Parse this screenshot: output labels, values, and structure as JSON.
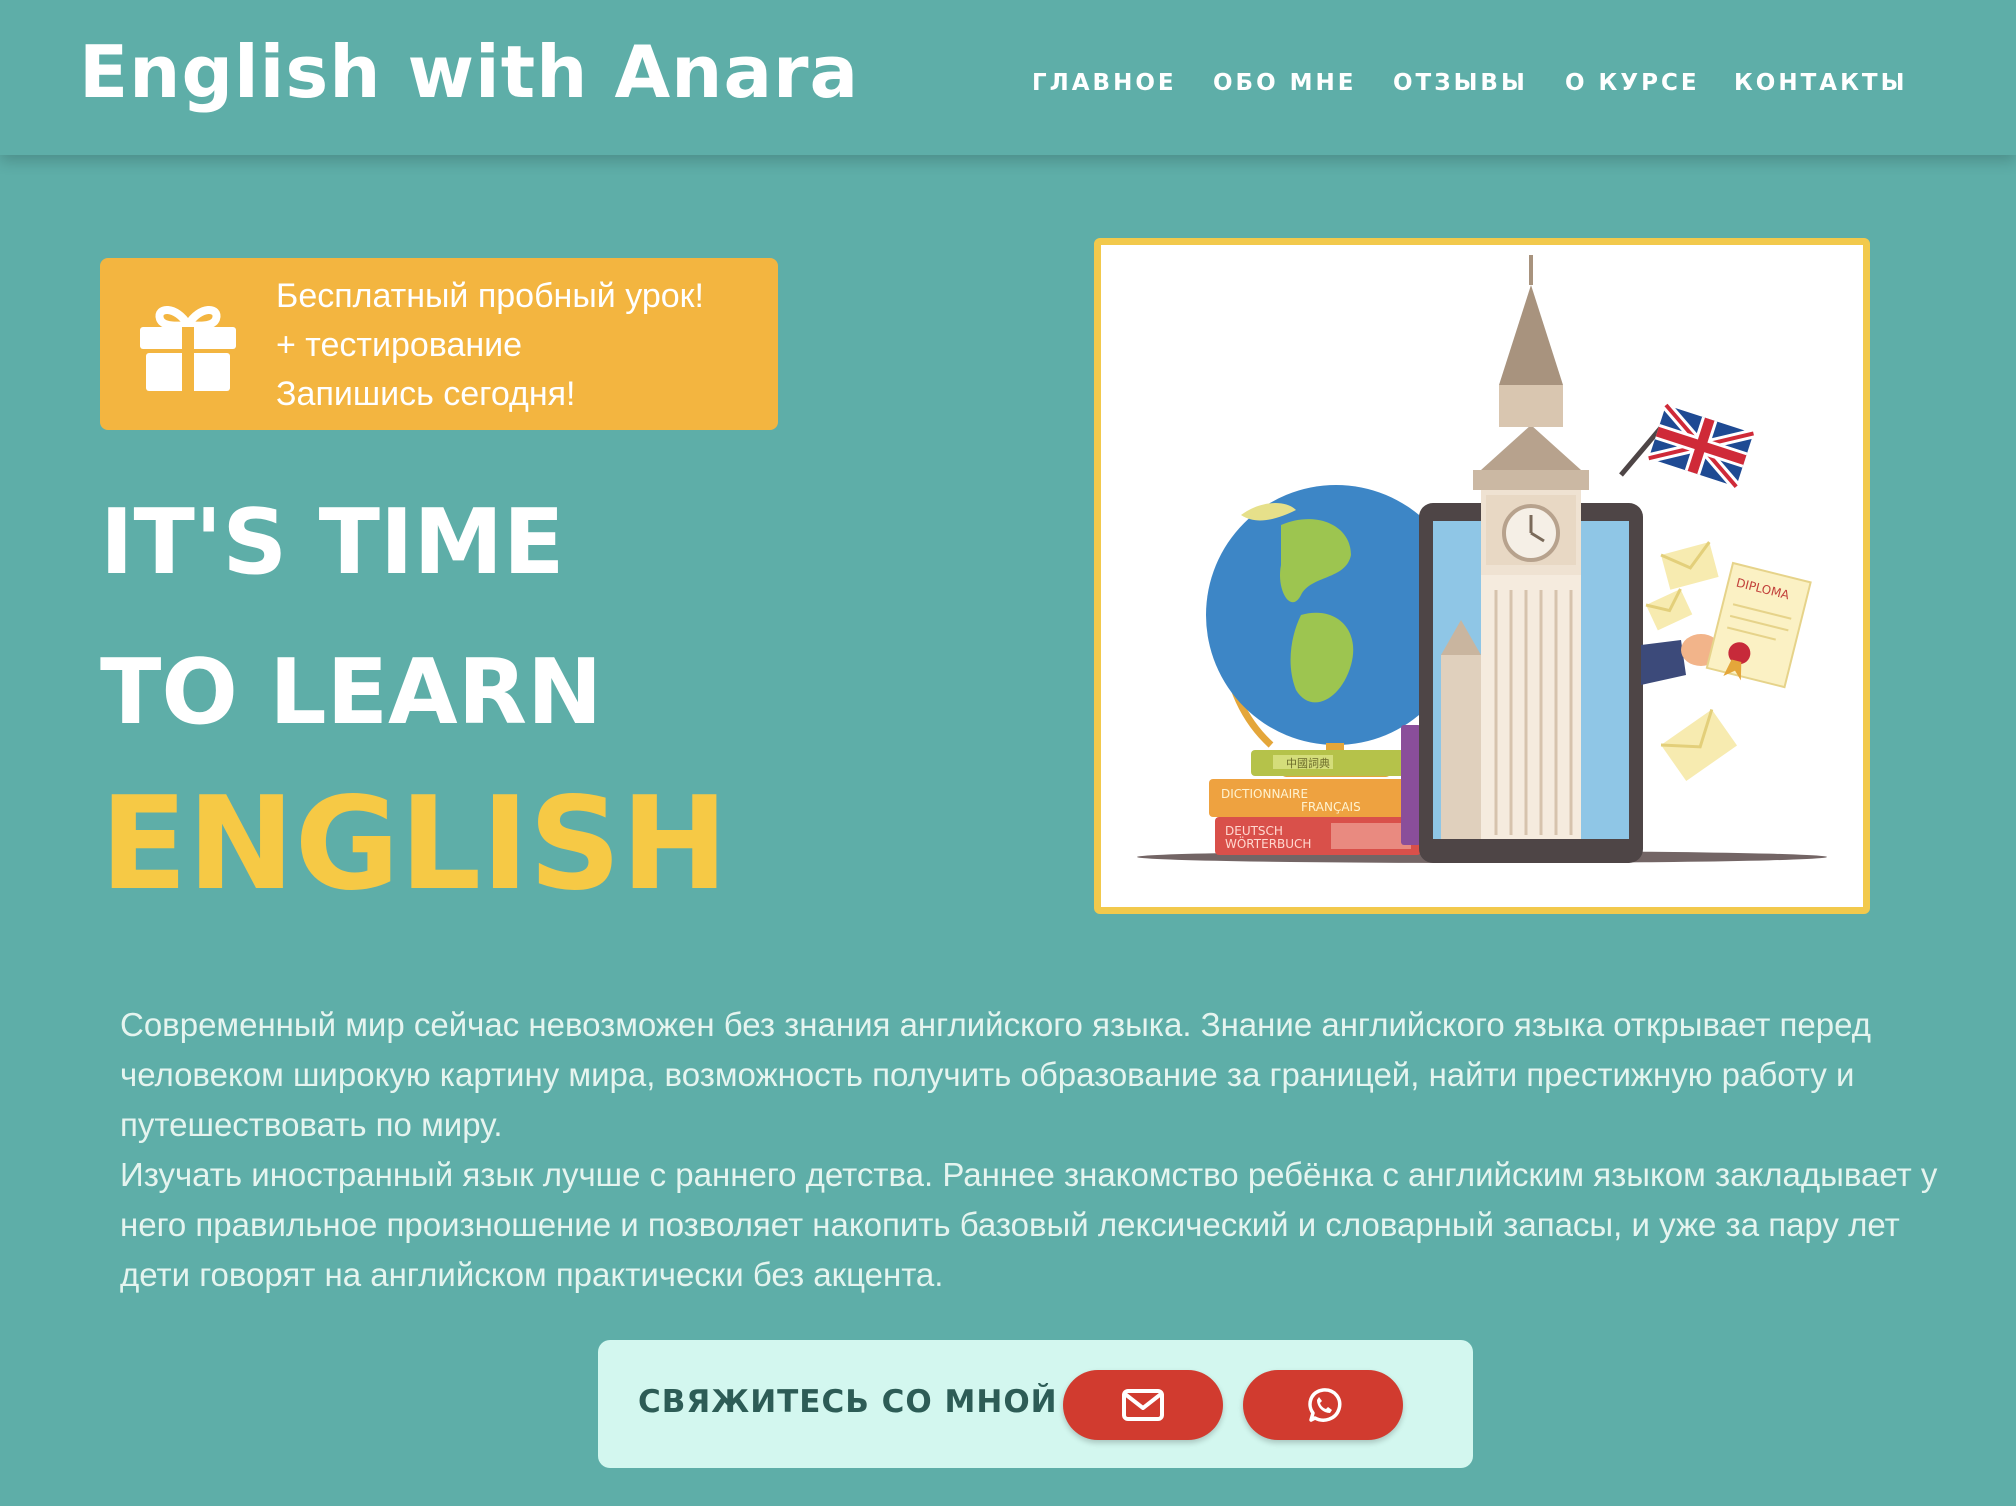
{
  "header": {
    "brand": "English with Anara",
    "nav": [
      "ГЛАВНОЕ",
      "ОБО МНЕ",
      "ОТЗЫВЫ",
      "О КУРСЕ",
      "КОНТАКТЫ"
    ]
  },
  "promo": {
    "icon": "gift-icon",
    "lines": [
      "Бесплатный пробный урок!",
      "+ тестирование",
      "Запишись сегодня!"
    ]
  },
  "headline": {
    "line1": "IT'S TIME",
    "line2": "TO LEARN",
    "line3": "ENGLISH"
  },
  "illustration": {
    "book_labels": [
      "中國詞典",
      "DICTIONNAIRE",
      "FRANÇAIS",
      "DEUTSCH",
      "WÖRTERBUCH"
    ],
    "diploma_label": "DIPLOMA"
  },
  "description": {
    "paragraph1": "Современный мир сейчас невозможен без знания английского языка. Знание английского языка открывает перед человеком широкую картину мира, возможность получить образование за границей, найти престижную работу и путешествовать по миру.",
    "paragraph2": "Изучать иностранный язык лучше с раннего детства. Раннее знакомство ребёнка с английским языком закладывает у него правильное произношение и позволяет накопить базовый лексический и словарный запасы, и уже за пару лет дети говорят на английском практически без акцента."
  },
  "contact": {
    "label": "СВЯЖИТЕСЬ СО МНОЙ",
    "buttons": [
      {
        "icon": "envelope-icon"
      },
      {
        "icon": "whatsapp-icon"
      }
    ]
  },
  "colors": {
    "background": "#5eaea8",
    "promo": "#f3b540",
    "accent_yellow": "#f6c945",
    "button_red": "#d13b2f",
    "contact_bg": "#d3f7ef"
  }
}
